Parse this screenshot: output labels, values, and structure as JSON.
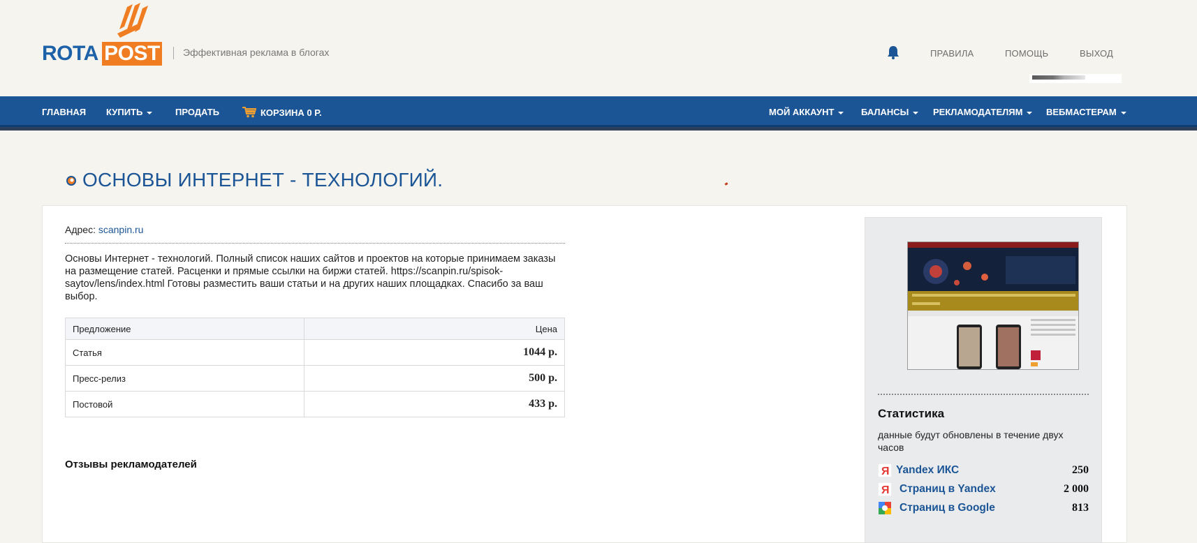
{
  "header": {
    "logo_left": "ROTA",
    "logo_right": "POST",
    "tagline": "Эффективная реклама в блогах",
    "links": {
      "rules": "ПРАВИЛА",
      "help": "ПОМОЩЬ",
      "logout": "ВЫХОД"
    }
  },
  "nav": {
    "left": [
      "ГЛАВНАЯ",
      "КУПИТЬ",
      "ПРОДАТЬ",
      "КОРЗИНА 0 Р."
    ],
    "right": [
      "МОЙ АККАУНТ",
      "БАЛАНСЫ",
      "РЕКЛАМОДАТЕЛЯМ",
      "ВЕБМАСТЕРАМ"
    ]
  },
  "page": {
    "title": "ОСНОВЫ ИНТЕРНЕТ - ТЕХНОЛОГИЙ.",
    "address_label": "Адрес:",
    "address_value": "scanpin.ru",
    "description": "Основы Интернет - технологий. Полный список наших сайтов и проектов на которые принимаем заказы на размещение статей. Расценки и прямые ссылки на биржи статей. https://scanpin.ru/spisok-saytov/lens/index.html Готовы разместить ваши статьи и на других наших площадках. Спасибо за ваш выбор.",
    "table": {
      "headers": [
        "Предложение",
        "Цена"
      ],
      "rows": [
        {
          "name": "Статья",
          "price": "1044 р."
        },
        {
          "name": "Пресс-релиз",
          "price": "500 р."
        },
        {
          "name": "Постовой",
          "price": "433 р."
        }
      ]
    },
    "reviews_title": "Отзывы рекламодателей"
  },
  "sidebar": {
    "stats_title": "Статистика",
    "stats_note": "данные будут обновлены в течение двух часов",
    "stats": [
      {
        "icon": "yandex-icon",
        "label": "Yandex ИКС",
        "value": "250"
      },
      {
        "icon": "yandex-icon",
        "label": "Страниц в Yandex",
        "value": "2 000"
      },
      {
        "icon": "google-icon",
        "label": "Страниц в Google",
        "value": "813"
      }
    ]
  },
  "colors": {
    "brand_blue": "#1b5596",
    "brand_orange": "#f07d21",
    "background": "#f5f4ef"
  }
}
